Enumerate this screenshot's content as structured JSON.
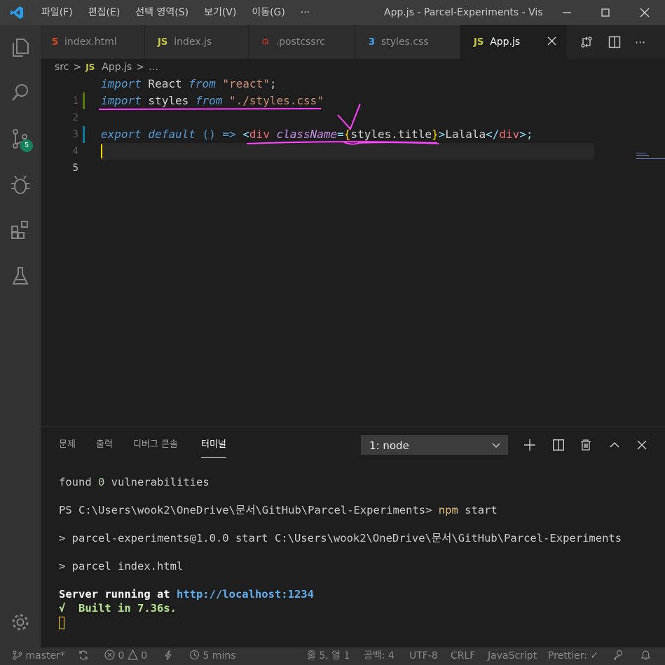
{
  "titlebar": {
    "menu": [
      "파일(F)",
      "편집(E)",
      "선택 영역(S)",
      "보기(V)",
      "이동(G)",
      "···"
    ],
    "title": "App.js - Parcel-Experiments - Vis"
  },
  "activity": {
    "scm_badge": "5"
  },
  "tabs": [
    {
      "label": "index.html",
      "icon": "5"
    },
    {
      "label": "index.js",
      "icon": "JS"
    },
    {
      "label": ".postcssrc",
      "icon": "⚙"
    },
    {
      "label": "styles.css",
      "icon": "3"
    },
    {
      "label": "App.js",
      "icon": "JS"
    }
  ],
  "breadcrumb": {
    "folder": "src",
    "sep1": ">",
    "icon": "JS",
    "file": "App.js",
    "sep2": ">",
    "more": "…"
  },
  "editor": {
    "line_numbers": [
      "1",
      "2",
      "3",
      "4",
      "5"
    ],
    "l1": {
      "kw1": "import",
      "id": " React ",
      "kw2": "from",
      "str": " \"react\"",
      "semi": ";"
    },
    "l2": {
      "kw1": "import",
      "id": " styles ",
      "kw2": "from",
      "str": " \"./styles.css\""
    },
    "l4": {
      "kw1": "export default",
      "paren": " () ",
      "arrow": "=>",
      "lt": " <",
      "tag": "div",
      "attr": " className",
      "eq": "=",
      "ob": "{",
      "expr": "styles.title",
      "cb": "}",
      "gt": ">",
      "text": "Lalala",
      "close_lt": "</",
      "close_tag": "div",
      "close_gt": ">;"
    }
  },
  "panel": {
    "tabs": [
      "문제",
      "출력",
      "디버그 콘솔",
      "터미널"
    ],
    "selected_terminal": "1: node"
  },
  "terminal": {
    "l1_a": "found ",
    "l1_b": "0",
    "l1_c": " vulnerabilities",
    "l2_a": "PS C:\\Users\\wook2\\OneDrive\\문서\\GitHub\\Parcel-Experiments> ",
    "l2_b": "npm",
    "l2_c": " start",
    "l3": "> parcel-experiments@1.0.0 start C:\\Users\\wook2\\OneDrive\\문서\\GitHub\\Parcel-Experiments",
    "l4": "> parcel index.html",
    "l5_a": "Server running at ",
    "l5_b": "http://localhost:1234",
    "l6": "√  Built in 7.36s."
  },
  "status": {
    "branch": "master*",
    "errors": "0",
    "warnings": "0",
    "time": "5 mins",
    "position": "줄 5, 열 1",
    "spaces": "공백: 4",
    "encoding": "UTF-8",
    "eol": "CRLF",
    "language": "JavaScript",
    "prettier": "Prettier: ✓"
  },
  "colors": {
    "accent": "#007acc",
    "annotation": "#ff44ff"
  }
}
